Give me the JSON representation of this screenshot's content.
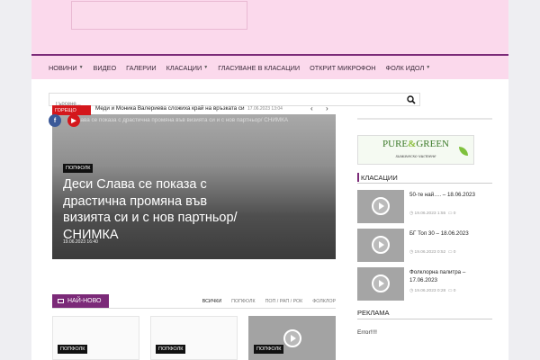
{
  "nav": {
    "items": [
      {
        "label": "НОВИНИ",
        "dropdown": true
      },
      {
        "label": "ВИДЕО",
        "dropdown": false
      },
      {
        "label": "ГАЛЕРИИ",
        "dropdown": false
      },
      {
        "label": "КЛАСАЦИИ",
        "dropdown": true
      },
      {
        "label": "ГЛАСУВАНЕ В КЛАСАЦИИ",
        "dropdown": false
      },
      {
        "label": "ОТКРИТ МИКРОФОН",
        "dropdown": false
      },
      {
        "label": "ФОЛК ИДОЛ",
        "dropdown": true
      }
    ]
  },
  "search": {
    "placeholder": "Търсене..."
  },
  "ticker": {
    "label": "ГОРЕЩО",
    "text": "Меди и Моника Валериева сложиха край на връзката си",
    "date": "17.06.2023 13:04"
  },
  "featured": {
    "top_text": "и Слава се показа с драстична промяна във визията си и с нов партньор/ СНИМКА",
    "category": "ПОПФОЛК",
    "title": "Деси Слава се показа с драстична промяна във визията си и с нов партньор/ СНИМКА",
    "date": "19.06.2023 16:40"
  },
  "latest": {
    "heading": "НАЙ-НОВО",
    "filters": [
      "ВСИЧКИ",
      "ПОПФОЛК",
      "ПОП / РАП / РОК",
      "ФОЛКЛОР"
    ],
    "cards": [
      {
        "category": "ПОПФОЛК"
      },
      {
        "category": "ПОПФОЛК"
      },
      {
        "category": "ПОПФОЛК"
      }
    ]
  },
  "ad": {
    "brand_left": "PURE",
    "brand_amp": "&",
    "brand_right": "GREEN",
    "subtitle": "химическо чистене"
  },
  "rankings": {
    "heading": "КЛАСАЦИИ",
    "items": [
      {
        "title": "50-те най…. – 18.06.2023",
        "date": "19.06.2023 1:55",
        "comments": "0"
      },
      {
        "title": "БГ Топ 30 – 18.06.2023",
        "date": "19.06.2023 0:52",
        "comments": "0"
      },
      {
        "title": "Фолклорна палитра – 17.06.2023",
        "date": "19.06.2023 0:28",
        "comments": "0"
      }
    ]
  },
  "advert": {
    "heading": "РЕКЛАМА",
    "text": "Error!!!!"
  },
  "colors": {
    "accent": "#7b2a78",
    "header_bg": "#fbd9ec",
    "hot": "#d4171c"
  }
}
